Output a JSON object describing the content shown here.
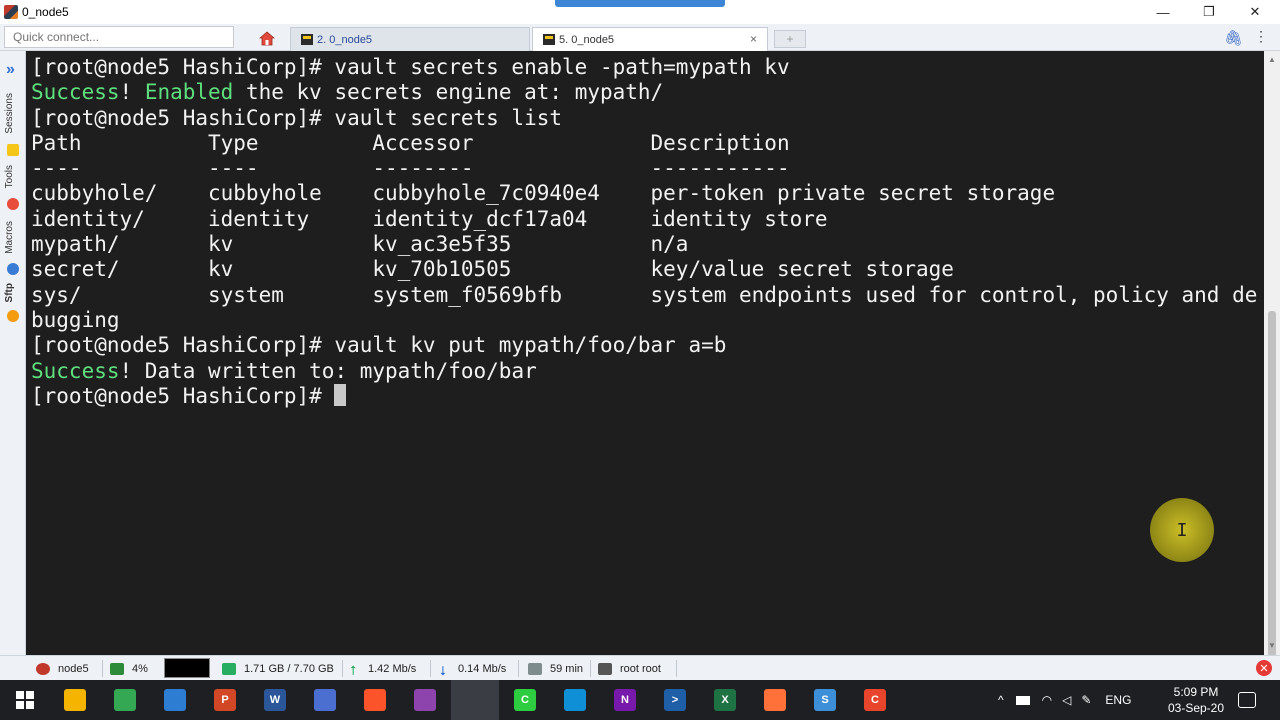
{
  "window": {
    "title": "0_node5",
    "minimize_glyph": "—",
    "maximize_glyph": "❐",
    "close_glyph": "✕"
  },
  "toolbar": {
    "quick_connect_placeholder": "Quick connect...",
    "home_icon": "home-icon",
    "tabs": [
      {
        "label": "2. 0_node5",
        "active": false
      },
      {
        "label": "5. 0_node5",
        "active": true,
        "close_glyph": "×"
      }
    ],
    "new_tab_glyph": "+",
    "attach_glyph": "🖇",
    "menu_glyph": "⋮"
  },
  "sidebar": {
    "expand_glyph": "»",
    "labels": [
      "Sessions",
      "Tools",
      "Macros",
      "Sftp"
    ]
  },
  "terminal": {
    "lines": [
      [
        {
          "t": "[root@node5 HashiCorp]# vault secrets enable -path=mypath kv"
        }
      ],
      [
        {
          "t": "Success",
          "c": "green"
        },
        {
          "t": "! "
        },
        {
          "t": "Enabled",
          "c": "green"
        },
        {
          "t": " the kv secrets engine at: mypath/"
        }
      ],
      [
        {
          "t": "[root@node5 HashiCorp]# vault secrets list"
        }
      ],
      [
        {
          "t": "Path          Type         Accessor              Description"
        }
      ],
      [
        {
          "t": "----          ----         --------              -----------"
        }
      ],
      [
        {
          "t": "cubbyhole/    cubbyhole    cubbyhole_7c0940e4    per-token private secret storage"
        }
      ],
      [
        {
          "t": "identity/     identity     identity_dcf17a04     identity store"
        }
      ],
      [
        {
          "t": "mypath/       kv           kv_ac3e5f35           n/a"
        }
      ],
      [
        {
          "t": "secret/       kv           kv_70b10505           key/value secret storage"
        }
      ],
      [
        {
          "t": "sys/          system       system_f0569bfb       system endpoints used for control, policy and de"
        }
      ],
      [
        {
          "t": "bugging"
        }
      ],
      [
        {
          "t": "[root@node5 HashiCorp]# vault kv put mypath/foo/bar a=b"
        }
      ],
      [
        {
          "t": "Success",
          "c": "green"
        },
        {
          "t": "! Data written to: mypath/foo/bar"
        }
      ],
      [
        {
          "t": "[root@node5 HashiCorp]# "
        }
      ]
    ],
    "pointer_glyph": "I"
  },
  "statusbar": {
    "host": "node5",
    "cpu": "4%",
    "memory": "1.71 GB / 7.70 GB",
    "upload": "1.42 Mb/s",
    "download": "0.14 Mb/s",
    "uptime": "59 min",
    "user": "root  root",
    "close_glyph": "✕"
  },
  "taskbar": {
    "start_icon": "windows-start-icon",
    "apps": [
      {
        "name": "file-explorer",
        "glyph": "",
        "color": "#f4b400"
      },
      {
        "name": "chrome",
        "glyph": "",
        "color": "#34a853"
      },
      {
        "name": "vmware",
        "glyph": "",
        "color": "#2d7dd2"
      },
      {
        "name": "powerpoint",
        "glyph": "P",
        "color": "#d24726"
      },
      {
        "name": "word",
        "glyph": "W",
        "color": "#2b579a"
      },
      {
        "name": "network",
        "glyph": "",
        "color": "#4a6fd1"
      },
      {
        "name": "brave",
        "glyph": "",
        "color": "#fb542b"
      },
      {
        "name": "app-globe",
        "glyph": "",
        "color": "#8e44ad"
      },
      {
        "name": "mobaxterm",
        "glyph": "",
        "color": "#3a3d44"
      },
      {
        "name": "camtasia",
        "glyph": "C",
        "color": "#2ecc40"
      },
      {
        "name": "edge",
        "glyph": "",
        "color": "#0f8fd6"
      },
      {
        "name": "onenote",
        "glyph": "N",
        "color": "#7719aa"
      },
      {
        "name": "powershell",
        "glyph": ">",
        "color": "#1f5fa8"
      },
      {
        "name": "excel",
        "glyph": "X",
        "color": "#1f7244"
      },
      {
        "name": "firefox",
        "glyph": "",
        "color": "#ff7139"
      },
      {
        "name": "app-s",
        "glyph": "S",
        "color": "#3d8fd8"
      },
      {
        "name": "app-c",
        "glyph": "C",
        "color": "#e8452c"
      }
    ],
    "tray_language": "ENG",
    "time": "5:09 PM",
    "date": "03-Sep-20"
  }
}
